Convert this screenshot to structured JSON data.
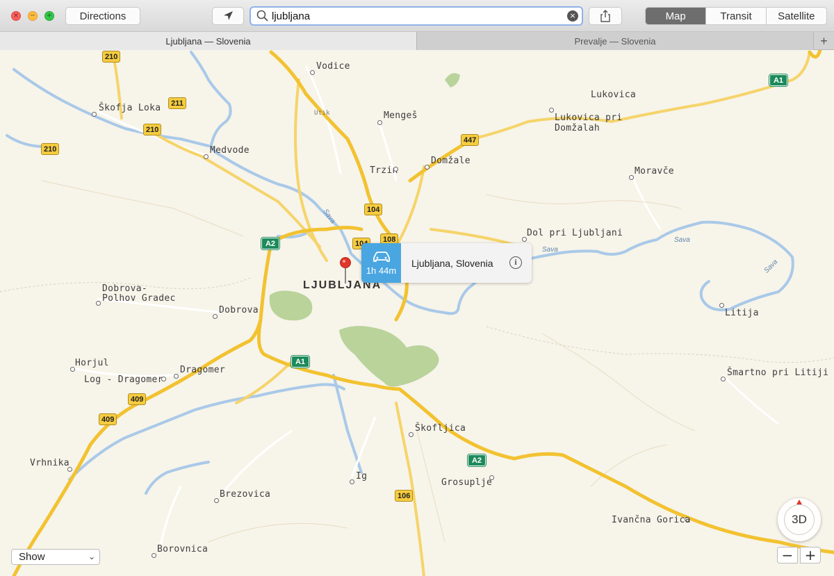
{
  "toolbar": {
    "directions_label": "Directions",
    "search_value": "ljubljana",
    "map_modes": [
      "Map",
      "Transit",
      "Satellite"
    ],
    "active_mode": "Map"
  },
  "tabs": {
    "active": "Ljubljana — Slovenia",
    "inactive": "Prevalje — Slovenia",
    "add": "+"
  },
  "map": {
    "city": "LJUBLJANA",
    "places": [
      "Vodice",
      "Škofja Loka",
      "Mengeš",
      "Lukovica",
      "Lukovica pri",
      "Domžalah",
      "Medvode",
      "Trzin",
      "Domžale",
      "Moravče",
      "Dol pri Ljubljani",
      "Dobrova-",
      "Polhov Gradec",
      "Dobrova",
      "Litija",
      "Horjul",
      "Dragomer",
      "Log - Dragomer",
      "Šmartno pri Litiji",
      "Škofljica",
      "Vrhnika",
      "Ig",
      "Grosuplje",
      "Brezovica",
      "Ivančna Gorica",
      "Borovnica"
    ],
    "rivers": [
      "Sava",
      "Sava",
      "Sava",
      "Sava"
    ],
    "small_label": "Utik",
    "shields": [
      "210",
      "211",
      "210",
      "210",
      "447",
      "104",
      "104",
      "108",
      "A2",
      "A1",
      "A1",
      "409",
      "409",
      "A2",
      "106"
    ]
  },
  "callout": {
    "drive_time": "1h 44m",
    "title": "Ljubljana, Slovenia"
  },
  "controls": {
    "show_label": "Show",
    "compass_label": "3D",
    "zoom_out": "−",
    "zoom_in": "+"
  },
  "colors": {
    "accent_blue": "#4aa6e0",
    "pin_red": "#e0362b",
    "motorway_green": "#1d8a5b",
    "road_yellow": "#f6cc3f"
  }
}
